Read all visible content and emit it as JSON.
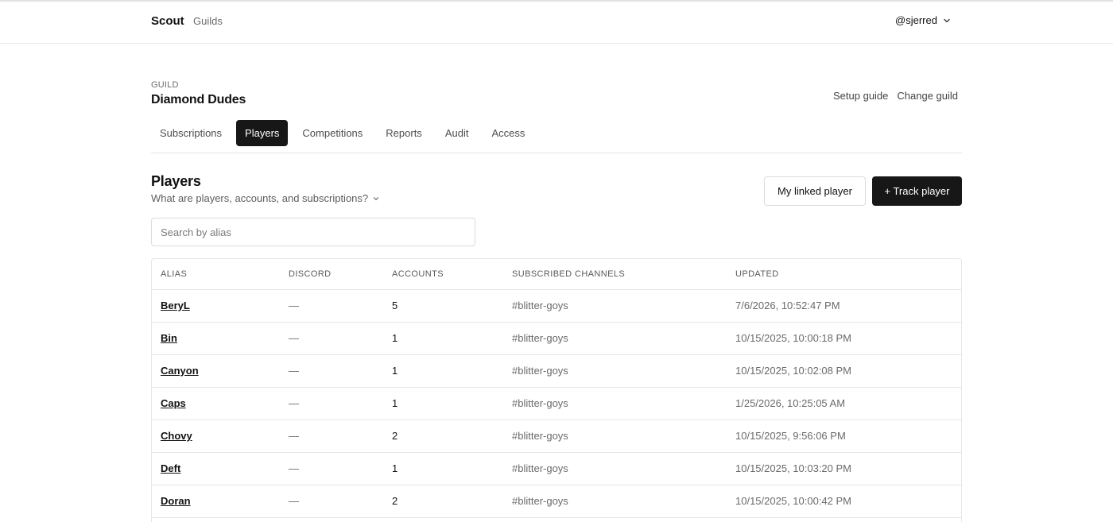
{
  "nav": {
    "brand": "Scout",
    "links": [
      "Guilds"
    ],
    "user": "@sjerred"
  },
  "guild": {
    "label": "GUILD",
    "name": "Diamond Dudes",
    "links": [
      "Setup guide",
      "Change guild"
    ]
  },
  "tabs": [
    {
      "label": "Subscriptions",
      "active": false
    },
    {
      "label": "Players",
      "active": true
    },
    {
      "label": "Competitions",
      "active": false
    },
    {
      "label": "Reports",
      "active": false
    },
    {
      "label": "Audit",
      "active": false
    },
    {
      "label": "Access",
      "active": false
    }
  ],
  "players": {
    "title": "Players",
    "help": "What are players, accounts, and subscriptions?",
    "linked_button": "My linked player",
    "track_button": "+ Track player",
    "search_placeholder": "Search by alias"
  },
  "table": {
    "columns": [
      "ALIAS",
      "DISCORD",
      "ACCOUNTS",
      "SUBSCRIBED CHANNELS",
      "UPDATED"
    ],
    "rows": [
      {
        "alias": "BeryL",
        "discord": "—",
        "accounts": "5",
        "channels": "#blitter-goys",
        "updated": "7/6/2026, 10:52:47 PM"
      },
      {
        "alias": "Bin",
        "discord": "—",
        "accounts": "1",
        "channels": "#blitter-goys",
        "updated": "10/15/2025, 10:00:18 PM"
      },
      {
        "alias": "Canyon",
        "discord": "—",
        "accounts": "1",
        "channels": "#blitter-goys",
        "updated": "10/15/2025, 10:02:08 PM"
      },
      {
        "alias": "Caps",
        "discord": "—",
        "accounts": "1",
        "channels": "#blitter-goys",
        "updated": "1/25/2026, 10:25:05 AM"
      },
      {
        "alias": "Chovy",
        "discord": "—",
        "accounts": "2",
        "channels": "#blitter-goys",
        "updated": "10/15/2025, 9:56:06 PM"
      },
      {
        "alias": "Deft",
        "discord": "—",
        "accounts": "1",
        "channels": "#blitter-goys",
        "updated": "10/15/2025, 10:03:20 PM"
      },
      {
        "alias": "Doran",
        "discord": "—",
        "accounts": "2",
        "channels": "#blitter-goys",
        "updated": "10/15/2025, 10:00:42 PM"
      }
    ]
  },
  "icons": {
    "user_menu": "chevron-down-icon",
    "help_toggle": "chevron-down-icon"
  }
}
